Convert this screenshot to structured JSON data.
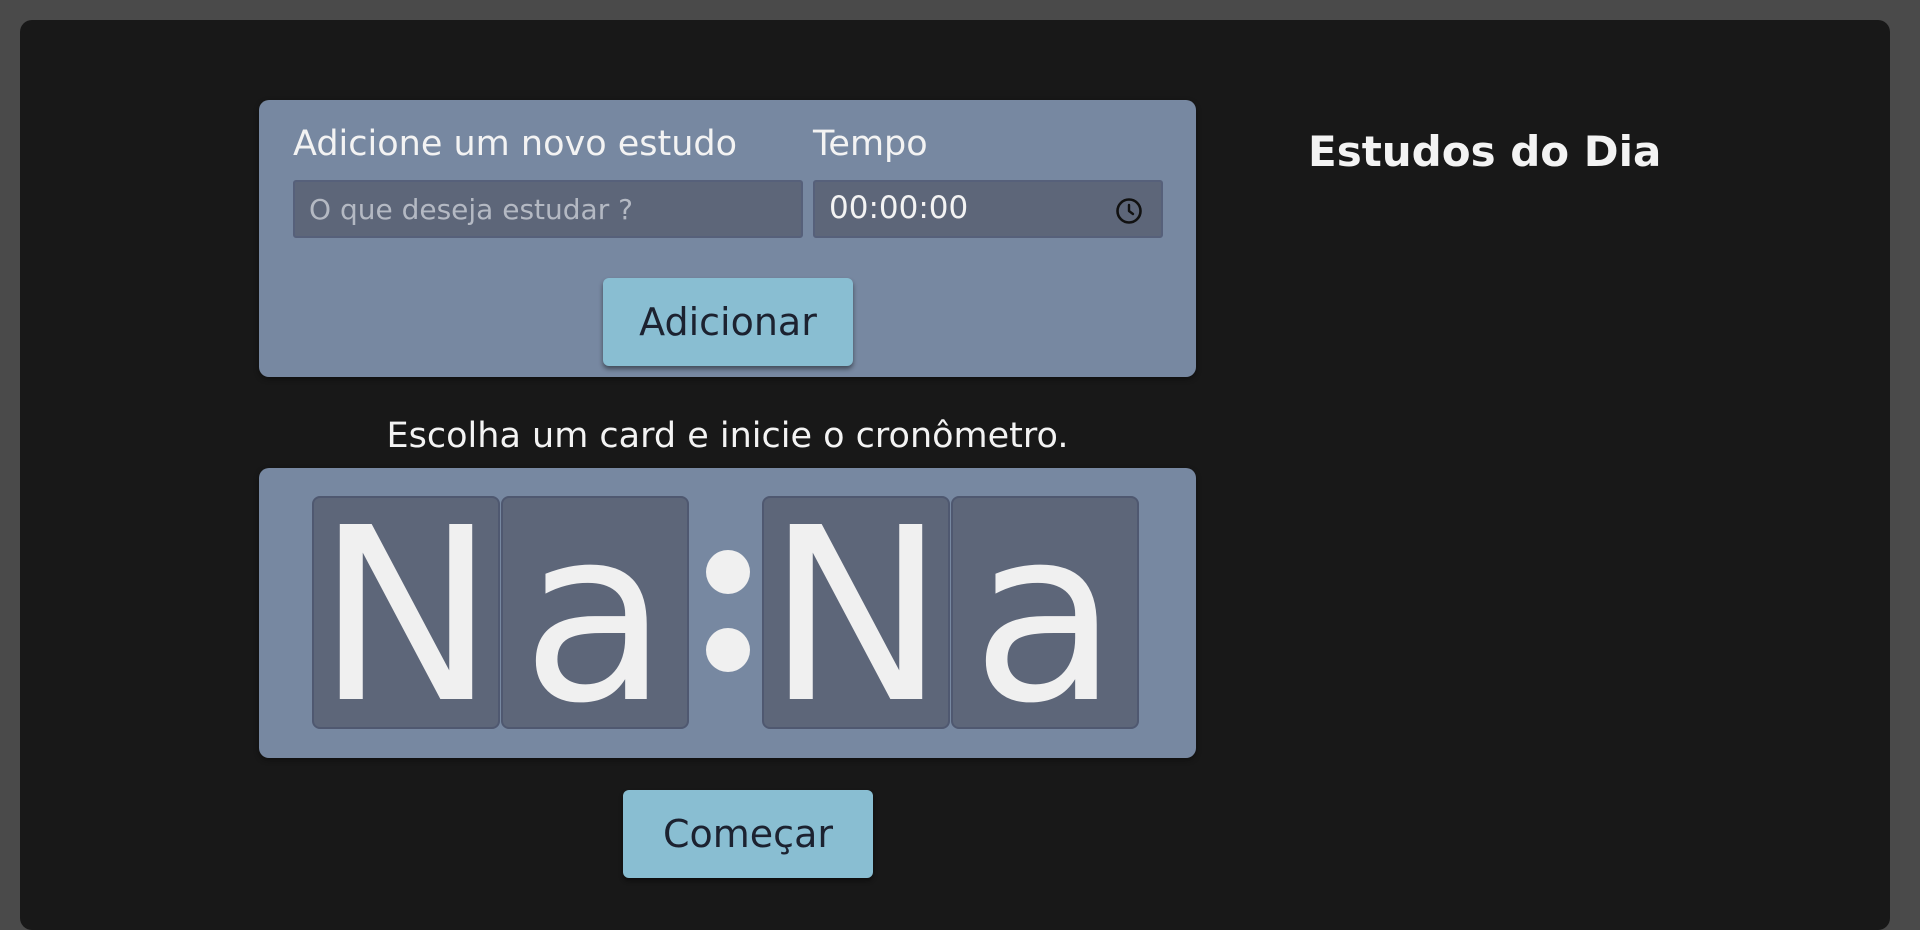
{
  "add_form": {
    "study_label": "Adicione um novo estudo",
    "study_placeholder": "O que deseja estudar ?",
    "study_value": "",
    "time_label": "Tempo",
    "time_value": "00:00:00",
    "add_button": "Adicionar"
  },
  "timer": {
    "hint": "Escolha um card e inicie o cronômetro.",
    "digits": [
      "N",
      "a",
      "N",
      "a"
    ],
    "separator": ":",
    "start_button": "Começar"
  },
  "sidebar": {
    "title": "Estudos do Dia"
  },
  "colors": {
    "background": "#181818",
    "panel": "#7788a1",
    "field": "#5d6679",
    "button": "#89bed2",
    "text": "#f3f3f3"
  },
  "icons": {
    "time_field_icon": "clock-icon"
  }
}
